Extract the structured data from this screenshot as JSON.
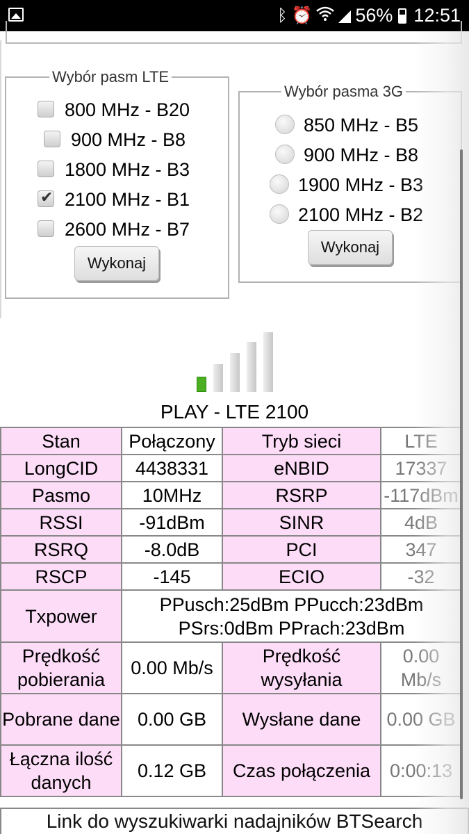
{
  "status_bar": {
    "battery": "56%",
    "time": "12:51",
    "icons": [
      "gallery-icon",
      "bluetooth-icon",
      "alarm-icon",
      "wifi-icon",
      "signal-icon",
      "battery-icon"
    ]
  },
  "lte_bands": {
    "legend": "Wybór pasm LTE",
    "options": [
      {
        "label": "800 MHz - B20",
        "checked": false
      },
      {
        "label": "900 MHz - B8",
        "checked": false
      },
      {
        "label": "1800 MHz - B3",
        "checked": false
      },
      {
        "label": "2100 MHz - B1",
        "checked": true
      },
      {
        "label": "2600 MHz - B7",
        "checked": false
      }
    ],
    "button": "Wykonaj"
  },
  "band_3g": {
    "legend": "Wybór pasma 3G",
    "options": [
      {
        "label": "850 MHz - B5"
      },
      {
        "label": "900 MHz - B8"
      },
      {
        "label": "1900 MHz - B3"
      },
      {
        "label": "2100 MHz - B2"
      }
    ],
    "button": "Wykonaj"
  },
  "signal": {
    "level": 1,
    "max": 5,
    "active_color": "#4caf22"
  },
  "operator": "PLAY - LTE 2100",
  "table": {
    "rows": [
      [
        "Stan",
        "Połączony",
        "Tryb sieci",
        "LTE"
      ],
      [
        "LongCID",
        "4438331",
        "eNBID",
        "17337"
      ],
      [
        "Pasmo",
        "10MHz",
        "RSRP",
        "-117dBm"
      ],
      [
        "RSSI",
        "-91dBm",
        "SINR",
        "4dB"
      ],
      [
        "RSRQ",
        "-8.0dB",
        "PCI",
        "347"
      ],
      [
        "RSCP",
        "-145",
        "ECIO",
        "-32"
      ]
    ],
    "txpower": {
      "label": "Txpower",
      "line1": "PPusch:25dBm PPucch:23dBm",
      "line2": "PSrs:0dBm PPrach:23dBm"
    },
    "speed": {
      "dl_label": "Prędkość pobierania",
      "dl_value": "0.00 Mb/s",
      "ul_label": "Prędkość wysyłania",
      "ul_value": "0.00 Mb/s"
    },
    "data": {
      "dl_label": "Pobrane dane",
      "dl_value": "0.00 GB",
      "ul_label": "Wysłane dane",
      "ul_value": "0.00 GB"
    },
    "total": {
      "label": "Łączna ilość danych",
      "value": "0.12 GB",
      "time_label": "Czas połączenia",
      "time_value": "0:00:13"
    }
  },
  "link": "Link do wyszukiwarki nadajników BTSearch",
  "colors": {
    "label_bg": "#fddcf7",
    "border": "#888888"
  }
}
